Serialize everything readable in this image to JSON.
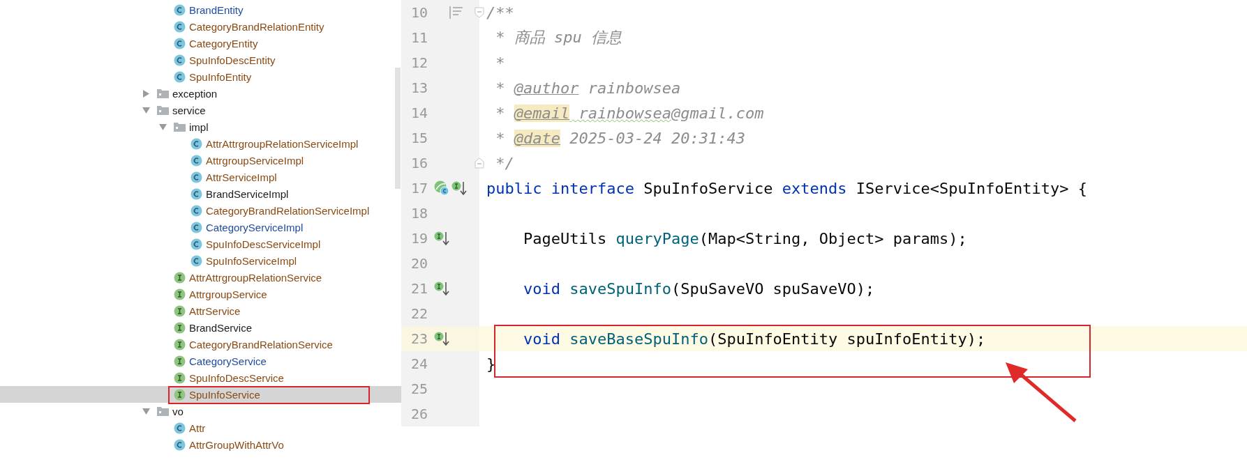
{
  "project_tree": {
    "continued_items": [
      {
        "kind": "class",
        "label": "BrandEntity",
        "color": "#1f4b9e",
        "selected": false,
        "annotated": false
      },
      {
        "kind": "class",
        "label": "CategoryBrandRelationEntity",
        "color": "#8a4a14",
        "selected": false,
        "annotated": false
      },
      {
        "kind": "class",
        "label": "CategoryEntity",
        "color": "#8a4a14",
        "selected": false,
        "annotated": false
      },
      {
        "kind": "class",
        "label": "SpuInfoDescEntity",
        "color": "#8a4a14",
        "selected": false,
        "annotated": false
      },
      {
        "kind": "class",
        "label": "SpuInfoEntity",
        "color": "#8a4a14",
        "selected": false,
        "annotated": false
      }
    ],
    "items": [
      {
        "kind": "folder",
        "label": "exception",
        "color": "#1a1a1a",
        "expanded": false,
        "selected": false,
        "annotated": false
      },
      {
        "kind": "folder",
        "label": "service",
        "color": "#1a1a1a",
        "expanded": true,
        "selected": false,
        "annotated": false,
        "children": [
          {
            "kind": "folder",
            "label": "impl",
            "color": "#1a1a1a",
            "expanded": true,
            "selected": false,
            "annotated": false,
            "children": [
              {
                "kind": "class",
                "label": "AttrAttrgroupRelationServiceImpl",
                "color": "#8a4a14",
                "selected": false,
                "annotated": false
              },
              {
                "kind": "class",
                "label": "AttrgroupServiceImpl",
                "color": "#8a4a14",
                "selected": false,
                "annotated": false
              },
              {
                "kind": "class",
                "label": "AttrServiceImpl",
                "color": "#8a4a14",
                "selected": false,
                "annotated": false
              },
              {
                "kind": "class",
                "label": "BrandServiceImpl",
                "color": "#1a1a1a",
                "selected": false,
                "annotated": false
              },
              {
                "kind": "class",
                "label": "CategoryBrandRelationServiceImpl",
                "color": "#8a4a14",
                "selected": false,
                "annotated": false
              },
              {
                "kind": "class",
                "label": "CategoryServiceImpl",
                "color": "#1f4b9e",
                "selected": false,
                "annotated": false
              },
              {
                "kind": "class",
                "label": "SpuInfoDescServiceImpl",
                "color": "#8a4a14",
                "selected": false,
                "annotated": false
              },
              {
                "kind": "class",
                "label": "SpuInfoServiceImpl",
                "color": "#8a4a14",
                "selected": false,
                "annotated": false
              }
            ]
          },
          {
            "kind": "interface",
            "label": "AttrAttrgroupRelationService",
            "color": "#8a4a14",
            "selected": false,
            "annotated": false
          },
          {
            "kind": "interface",
            "label": "AttrgroupService",
            "color": "#8a4a14",
            "selected": false,
            "annotated": false
          },
          {
            "kind": "interface",
            "label": "AttrService",
            "color": "#8a4a14",
            "selected": false,
            "annotated": false
          },
          {
            "kind": "interface",
            "label": "BrandService",
            "color": "#1a1a1a",
            "selected": false,
            "annotated": false
          },
          {
            "kind": "interface",
            "label": "CategoryBrandRelationService",
            "color": "#8a4a14",
            "selected": false,
            "annotated": false
          },
          {
            "kind": "interface",
            "label": "CategoryService",
            "color": "#1f4b9e",
            "selected": false,
            "annotated": false
          },
          {
            "kind": "interface",
            "label": "SpuInfoDescService",
            "color": "#8a4a14",
            "selected": false,
            "annotated": false
          },
          {
            "kind": "interface",
            "label": "SpuInfoService",
            "color": "#8a4a14",
            "selected": true,
            "annotated": true
          }
        ]
      },
      {
        "kind": "folder",
        "label": "vo",
        "color": "#1a1a1a",
        "expanded": true,
        "selected": false,
        "annotated": false,
        "children": [
          {
            "kind": "class",
            "label": "Attr",
            "color": "#8a4a14",
            "selected": false,
            "annotated": false
          },
          {
            "kind": "class",
            "label": "AttrGroupWithAttrVo",
            "color": "#8a4a14",
            "selected": false,
            "annotated": false
          }
        ]
      }
    ]
  },
  "editor": {
    "lines": [
      {
        "number": "10",
        "gutter_icons": [
          {
            "kind": "structure"
          }
        ],
        "fold_marker": {
          "kind": "start"
        },
        "current": false,
        "annotated": false,
        "tokens": [
          {
            "kind": "comment",
            "text": "/**"
          }
        ]
      },
      {
        "number": "11",
        "current": false,
        "annotated": false,
        "tokens": [
          {
            "kind": "comment",
            "text": " * 商品 spu 信息"
          }
        ]
      },
      {
        "number": "12",
        "current": false,
        "annotated": false,
        "tokens": [
          {
            "kind": "comment",
            "text": " *"
          }
        ]
      },
      {
        "number": "13",
        "current": false,
        "annotated": false,
        "tokens": [
          {
            "kind": "comment",
            "text": " * "
          },
          {
            "kind": "doctag",
            "text": "@author",
            "highlight": false
          },
          {
            "kind": "comment",
            "text": " rainbowsea"
          }
        ]
      },
      {
        "number": "14",
        "current": false,
        "annotated": false,
        "tokens": [
          {
            "kind": "comment",
            "text": " * "
          },
          {
            "kind": "doctag",
            "text": "@email",
            "highlight": true
          },
          {
            "kind": "typo",
            "text": " rainbowsea"
          },
          {
            "kind": "comment",
            "text": "@gmail.com"
          }
        ]
      },
      {
        "number": "15",
        "current": false,
        "annotated": false,
        "tokens": [
          {
            "kind": "comment",
            "text": " * "
          },
          {
            "kind": "doctag",
            "text": "@date",
            "highlight": true
          },
          {
            "kind": "comment",
            "text": " 2025-03-24 20:31:43"
          }
        ]
      },
      {
        "number": "16",
        "fold_marker": {
          "kind": "end"
        },
        "current": false,
        "annotated": false,
        "tokens": [
          {
            "kind": "comment",
            "text": " */"
          }
        ]
      },
      {
        "number": "17",
        "gutter_icons": [
          {
            "kind": "bean"
          },
          {
            "kind": "implemented"
          }
        ],
        "current": false,
        "annotated": false,
        "tokens": [
          {
            "kind": "keyword",
            "text": "public interface"
          },
          {
            "kind": "plain",
            "text": " SpuInfoService "
          },
          {
            "kind": "keyword",
            "text": "extends"
          },
          {
            "kind": "plain",
            "text": " IService<SpuInfoEntity> {"
          }
        ]
      },
      {
        "number": "18",
        "current": false,
        "annotated": false
      },
      {
        "number": "19",
        "gutter_icons": [
          {
            "kind": "implemented"
          }
        ],
        "current": false,
        "annotated": false,
        "tokens": [
          {
            "kind": "plain",
            "text": "    PageUtils "
          },
          {
            "kind": "method",
            "text": "queryPage"
          },
          {
            "kind": "plain",
            "text": "(Map<String, Object> params);"
          }
        ]
      },
      {
        "number": "20",
        "current": false,
        "annotated": false
      },
      {
        "number": "21",
        "gutter_icons": [
          {
            "kind": "implemented"
          }
        ],
        "current": false,
        "annotated": false,
        "tokens": [
          {
            "kind": "keyword",
            "text": "    void "
          },
          {
            "kind": "method",
            "text": "saveSpuInfo"
          },
          {
            "kind": "plain",
            "text": "(SpuSaveVO spuSaveVO);"
          }
        ]
      },
      {
        "number": "22",
        "current": false,
        "annotated": false
      },
      {
        "number": "23",
        "gutter_icons": [
          {
            "kind": "implemented"
          }
        ],
        "current": true,
        "annotated": true,
        "tokens": [
          {
            "kind": "keyword",
            "text": "    void "
          },
          {
            "kind": "method",
            "text": "saveBaseSpuInfo"
          },
          {
            "kind": "plain",
            "text": "(SpuInfoEntity spuInfoEntity);"
          }
        ]
      },
      {
        "number": "24",
        "current": false,
        "annotated": false,
        "tokens": [
          {
            "kind": "plain",
            "text": "}"
          }
        ]
      },
      {
        "number": "25",
        "current": false,
        "annotated": false
      },
      {
        "number": "26",
        "current": false,
        "annotated": false
      }
    ]
  }
}
